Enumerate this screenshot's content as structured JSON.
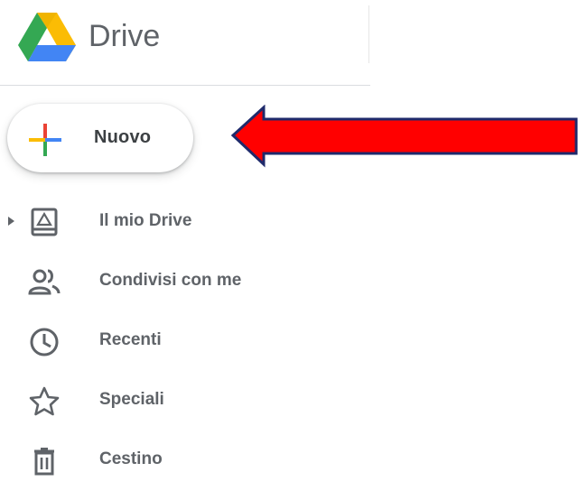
{
  "header": {
    "title": "Drive",
    "logo_icon": "google-drive-logo"
  },
  "new_button": {
    "label": "Nuovo",
    "icon": "plus-icon"
  },
  "annotation": {
    "arrow_color": "#ff0000",
    "arrow_outline": "#1f2a6b"
  },
  "sidebar": {
    "items": [
      {
        "label": "Il mio Drive",
        "icon": "my-drive-icon"
      },
      {
        "label": "Condivisi con me",
        "icon": "people-icon"
      },
      {
        "label": "Recenti",
        "icon": "clock-icon"
      },
      {
        "label": "Speciali",
        "icon": "star-icon"
      },
      {
        "label": "Cestino",
        "icon": "trash-icon"
      }
    ]
  },
  "colors": {
    "text": "#5f6368",
    "google_blue": "#4285f4",
    "google_red": "#ea4335",
    "google_yellow": "#fbbc04",
    "google_green": "#34a853"
  }
}
